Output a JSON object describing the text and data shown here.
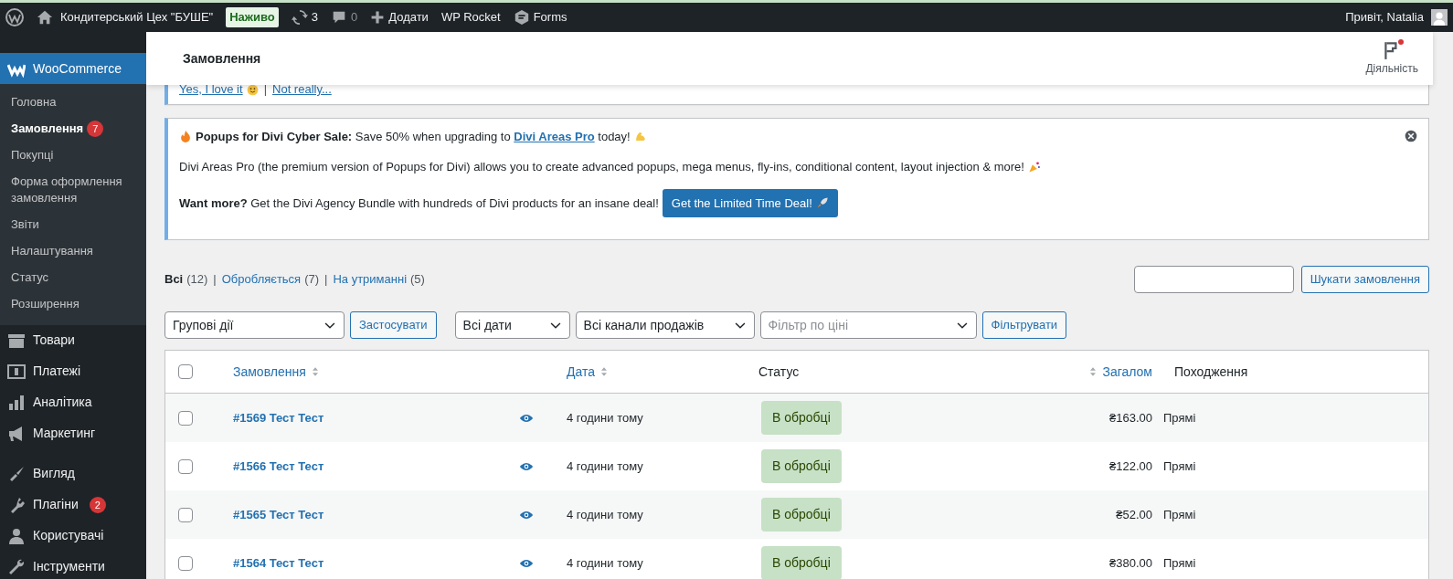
{
  "admin_bar": {
    "site_name": "Кондитерський Цех \"БУШЕ\"",
    "live_badge": "Наживо",
    "updates_count": "3",
    "comments_count": "0",
    "add_label": "Додати",
    "plugin_links": [
      "WP Rocket",
      "Forms"
    ],
    "greeting": "Привіт, Natalia"
  },
  "sidebar": {
    "items": [
      {
        "label": "WooCommerce",
        "selected": true,
        "children": [
          {
            "label": "Головна",
            "selected": false
          },
          {
            "label": "Замовлення",
            "selected": true,
            "badge": "7"
          },
          {
            "label": "Покупці",
            "selected": false
          },
          {
            "label": "Форма оформлення замовлення",
            "selected": false
          },
          {
            "label": "Звіти",
            "selected": false
          },
          {
            "label": "Налаштування",
            "selected": false
          },
          {
            "label": "Статус",
            "selected": false
          },
          {
            "label": "Розширення",
            "selected": false
          }
        ]
      },
      {
        "label": "Товари",
        "selected": false
      },
      {
        "label": "Платежі",
        "selected": false
      },
      {
        "label": "Аналітика",
        "selected": false
      },
      {
        "label": "Маркетинг",
        "selected": false
      },
      {
        "label": "Вигляд",
        "selected": false
      },
      {
        "label": "Плагіни",
        "selected": false,
        "badge": "2"
      },
      {
        "label": "Користувачі",
        "selected": false
      },
      {
        "label": "Інструменти",
        "selected": false
      }
    ]
  },
  "header": {
    "title": "Замовлення",
    "activity_label": "Діяльність",
    "activity_unread": true
  },
  "review_notice": {
    "links": [
      "Yes, I love it",
      "Not really..."
    ],
    "separator": "|"
  },
  "promo_notice": {
    "headline_before": "**Popups for Divi Cyber Sale:** Save 50% when upgrading to ",
    "headline_link": "Divi Areas Pro",
    "headline_after": " today!",
    "body": "Divi Areas Pro (the premium version of Popups for Divi) allows you to create advanced popups, mega menus, fly-ins, conditional content, layout injection & more!",
    "cta_text": "**Want more?** Get the Divi Agency Bundle with hundreds of Divi products for an insane deal!",
    "cta_button": "Get the Limited Time Deal!"
  },
  "views_separator": "|",
  "views": [
    {
      "label": "Всі",
      "count": "(12)",
      "selected": true
    },
    {
      "label": "Обробляється",
      "count": "(7)",
      "selected": false
    },
    {
      "label": "На утриманні",
      "count": "(5)",
      "selected": false
    }
  ],
  "search": {
    "button": "Шукати замовлення"
  },
  "filters": {
    "bulk_action": "Групові дії",
    "apply": "Застосувати",
    "dates": "Всі дати",
    "channels": "Всі канали продажів",
    "price_placeholder": "Фільтр по ціні",
    "filter": "Фільтрувати"
  },
  "table": {
    "select_all_checked": false,
    "columns": [
      {
        "label": "Замовлення",
        "sortable": true
      },
      {
        "label": "Дата",
        "sortable": true
      },
      {
        "label": "Статус",
        "sortable": false
      },
      {
        "label": "Загалом",
        "sortable": true
      },
      {
        "label": "Походження",
        "sortable": false
      }
    ],
    "rows": [
      {
        "checked": false,
        "order": "#1569 Тест Тест",
        "date": "4 години тому",
        "status": "В обробці",
        "total": "₴163.00",
        "origin": "Прямі"
      },
      {
        "checked": false,
        "order": "#1566 Тест Тест",
        "date": "4 години тому",
        "status": "В обробці",
        "total": "₴122.00",
        "origin": "Прямі"
      },
      {
        "checked": false,
        "order": "#1565 Тест Тест",
        "date": "4 години тому",
        "status": "В обробці",
        "total": "₴52.00",
        "origin": "Прямі"
      },
      {
        "checked": false,
        "order": "#1564 Тест Тест",
        "date": "4 години тому",
        "status": "В обробці",
        "total": "₴380.00",
        "origin": "Прямі"
      }
    ]
  }
}
